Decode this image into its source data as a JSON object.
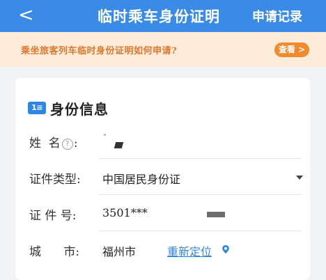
{
  "header": {
    "back_icon": "chevron-left-icon",
    "back_glyph": "<",
    "title": "临时乘车身份证明",
    "records_label": "申请记录"
  },
  "notice": {
    "text": "乘坐旅客列车临时身份证明如何申请?",
    "button_label": "查看 >"
  },
  "card": {
    "icon": "id-card-icon",
    "icon_glyph": "1≡",
    "title": "身份信息",
    "fields": {
      "name_label": "姓  名",
      "name_colon": ":",
      "name_help_glyph": "?",
      "doc_type_label": "证件类型:",
      "doc_type_value": "中国居民身份证",
      "id_number_label": "证 件 号:",
      "id_number_value": "3501***",
      "city_label": "城      市:",
      "city_value": "福州市",
      "relocate_label": "重新定位"
    }
  },
  "colors": {
    "header_bg": "#3a8be6",
    "notice_bg": "#fcecd9",
    "notice_text": "#e2762a",
    "button_bg": "#f08a2c",
    "link": "#2f86e0"
  }
}
